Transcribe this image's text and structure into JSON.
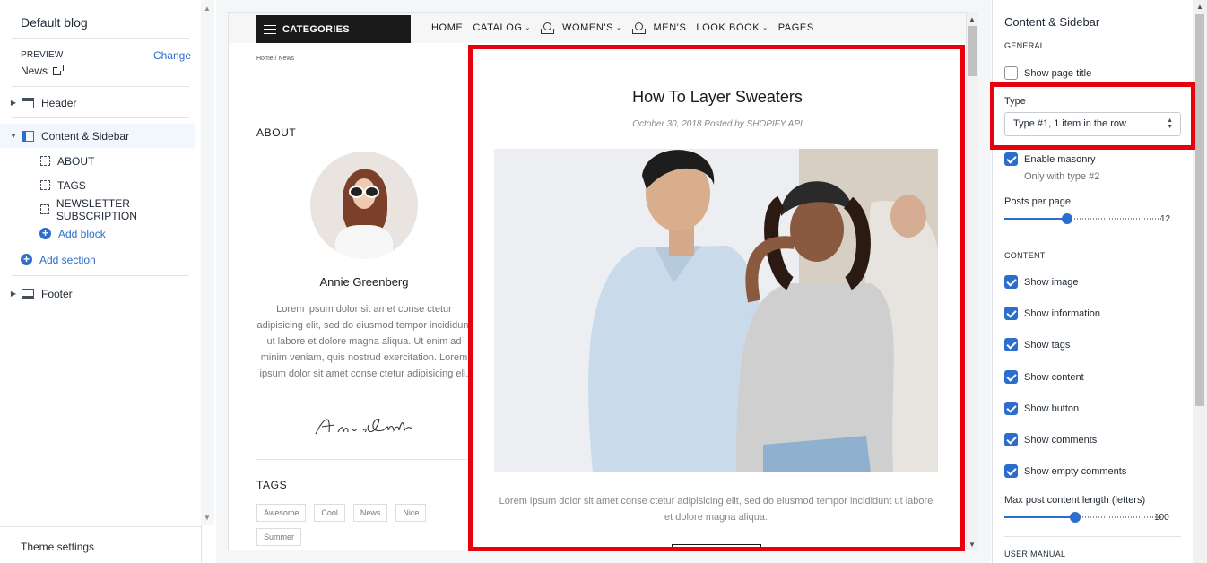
{
  "left": {
    "blog_title": "Default blog",
    "preview_label": "PREVIEW",
    "change_label": "Change",
    "preview_page": "News",
    "sections": [
      {
        "label": "Header"
      },
      {
        "label": "Content & Sidebar"
      },
      {
        "label": "Footer"
      }
    ],
    "blocks": [
      "ABOUT",
      "TAGS",
      "NEWSLETTER SUBSCRIPTION"
    ],
    "add_block": "Add block",
    "add_section": "Add section",
    "theme_settings": "Theme settings"
  },
  "preview": {
    "categories_label": "CATEGORIES",
    "nav": [
      "HOME",
      "CATALOG",
      "WOMEN'S",
      "MEN'S",
      "LOOK BOOK",
      "PAGES"
    ],
    "breadcrumb": "Home  /  News",
    "about_title": "ABOUT",
    "author_name": "Annie Greenberg",
    "bio": "Lorem ipsum dolor sit amet conse ctetur adipisicing elit, sed do eiusmod tempor incididunt ut labore et dolore magna aliqua. Ut enim ad minim veniam, quis nostrud exercitation. Lorem ipsum dolor sit amet conse ctetur adipisicing eli.",
    "tags_title": "TAGS",
    "tags": [
      "Awesome",
      "Cool",
      "News",
      "Nice",
      "Summer"
    ],
    "post": {
      "title": "How To Layer Sweaters",
      "meta": "October 30, 2018 Posted by SHOPIFY API",
      "excerpt": "Lorem ipsum dolor sit amet conse ctetur adipisicing elit, sed do eiusmod tempor incididunt ut labore et dolore magna aliqua."
    }
  },
  "right": {
    "title": "Content & Sidebar",
    "general_label": "GENERAL",
    "show_page_title": {
      "label": "Show page title",
      "checked": false
    },
    "type_label": "Type",
    "type_value": "Type #1, 1 item in the row",
    "enable_masonry": {
      "label": "Enable masonry",
      "checked": true
    },
    "masonry_help": "Only with type #2",
    "posts_per_page_label": "Posts per page",
    "posts_per_page_value": "12",
    "posts_per_page_fraction": 0.4,
    "content_label": "CONTENT",
    "content_options": [
      {
        "label": "Show image",
        "checked": true
      },
      {
        "label": "Show information",
        "checked": true
      },
      {
        "label": "Show tags",
        "checked": true
      },
      {
        "label": "Show content",
        "checked": true
      },
      {
        "label": "Show button",
        "checked": true
      },
      {
        "label": "Show comments",
        "checked": true
      },
      {
        "label": "Show empty comments",
        "checked": true
      }
    ],
    "max_length_label": "Max post content length (letters)",
    "max_length_value": "100",
    "max_length_fraction": 0.45,
    "user_manual_label": "USER MANUAL"
  },
  "colors": {
    "accent": "#2c6ecb",
    "highlight": "#e8000b"
  }
}
